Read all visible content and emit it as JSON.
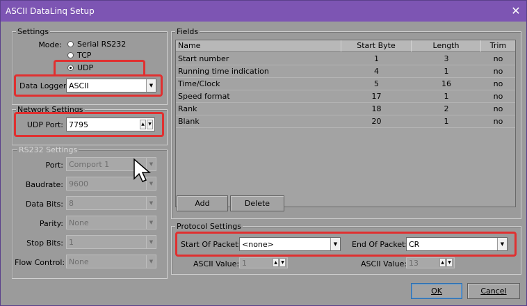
{
  "window": {
    "title": "ASCII DataLinq Setup",
    "close_glyph": "✕"
  },
  "settings": {
    "group_label": "Settings",
    "mode_label": "Mode:",
    "modes": [
      "Serial RS232",
      "TCP",
      "UDP"
    ],
    "selected_mode": "UDP",
    "data_logger_label": "Data Logger:",
    "data_logger_value": "ASCII"
  },
  "network": {
    "group_label": "Network Settings",
    "udp_port_label": "UDP Port:",
    "udp_port_value": "7795"
  },
  "rs232": {
    "group_label": "RS232 Settings",
    "port_label": "Port:",
    "port_value": "Comport 1",
    "baudrate_label": "Baudrate:",
    "baudrate_value": "9600",
    "databits_label": "Data Bits:",
    "databits_value": "8",
    "parity_label": "Parity:",
    "parity_value": "None",
    "stopbits_label": "Stop Bits:",
    "stopbits_value": "1",
    "flow_label": "Flow Control:",
    "flow_value": "None"
  },
  "fields": {
    "group_label": "Fields",
    "columns": [
      "Name",
      "Start Byte",
      "Length",
      "Trim"
    ],
    "rows": [
      [
        "Start number",
        "1",
        "3",
        "no"
      ],
      [
        "Running time indication",
        "4",
        "1",
        "no"
      ],
      [
        "Time/Clock",
        "5",
        "16",
        "no"
      ],
      [
        "Speed format",
        "17",
        "1",
        "no"
      ],
      [
        "Rank",
        "18",
        "2",
        "no"
      ],
      [
        "Blank",
        "20",
        "1",
        "no"
      ]
    ],
    "add_label": "Add",
    "delete_label": "Delete"
  },
  "protocol": {
    "group_label": "Protocol Settings",
    "start_label": "Start Of Packet:",
    "start_value": "<none>",
    "end_label": "End Of Packet:",
    "end_value": "CR",
    "ascii_label_1": "ASCII Value:",
    "ascii_value_1": "1",
    "ascii_label_2": "ASCII Value:",
    "ascii_value_2": "13"
  },
  "buttons": {
    "ok_label": "OK",
    "cancel_label": "Cancel"
  },
  "colors": {
    "titlebar": "#7d55b3",
    "highlight": "#e03030",
    "dialog_bg": "#9b9b9b"
  }
}
